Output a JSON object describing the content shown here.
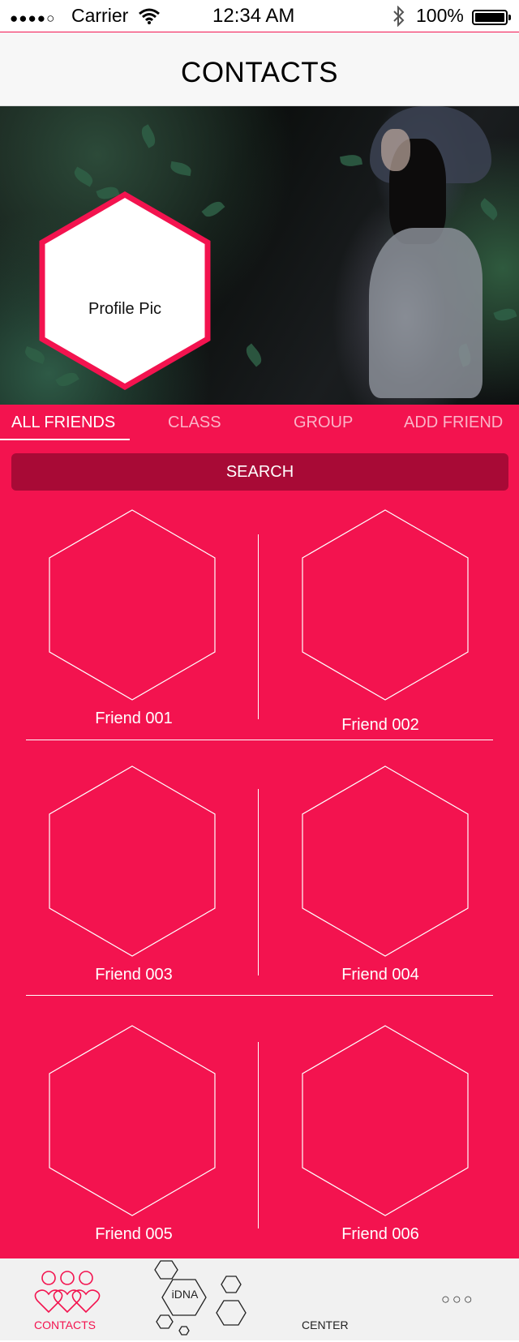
{
  "status_bar": {
    "signal": "●●●●○",
    "carrier": "Carrier",
    "time": "12:34 AM",
    "battery": "100%"
  },
  "nav": {
    "title": "CONTACTS"
  },
  "profile": {
    "label": "Profile Pic"
  },
  "tabs": [
    {
      "label": "ALL FRIENDS",
      "active": true
    },
    {
      "label": "CLASS",
      "active": false
    },
    {
      "label": "GROUP",
      "active": false
    },
    {
      "label": "ADD FRIEND",
      "active": false
    }
  ],
  "search": {
    "label": "SEARCH"
  },
  "friends": [
    {
      "name": "Friend 001"
    },
    {
      "name": "Friend 002"
    },
    {
      "name": "Friend 003"
    },
    {
      "name": "Friend 004"
    },
    {
      "name": "Friend 005"
    },
    {
      "name": "Friend 006"
    }
  ],
  "tabbar": {
    "contacts_label": "CONTACTS",
    "idna_label": "iDNA",
    "center_label": "CENTER",
    "more_label": "○○○"
  },
  "colors": {
    "accent": "#f3134f",
    "search_bg": "#a80a36"
  }
}
